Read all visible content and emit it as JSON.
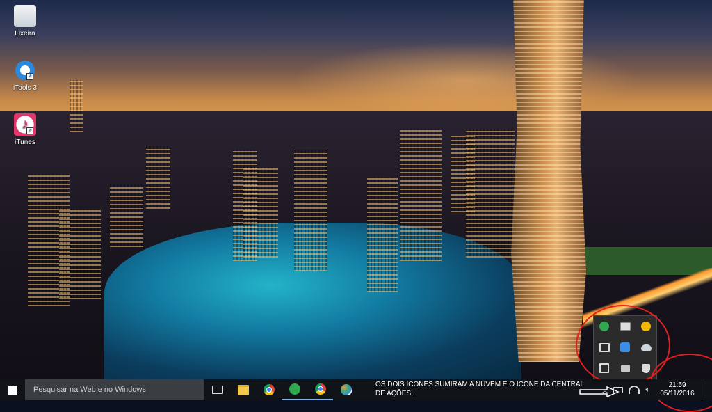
{
  "desktop": {
    "icons": [
      {
        "label": "Lixeira"
      },
      {
        "label": "iTools 3"
      },
      {
        "label": "iTunes"
      }
    ]
  },
  "taskbar": {
    "search_placeholder": "Pesquisar na Web e no Windows",
    "annotation_text": "OS DOIS ICONES SUMIRAM A NUVEM E O ICONE DA CENTRAL DE AÇÕES,",
    "clock": {
      "time": "21:59",
      "date": "05/11/2016"
    }
  },
  "tray_flyout": {
    "icons": [
      "green-circle-icon",
      "card-icon",
      "yellow-circle-icon",
      "window-icon",
      "blue-app-icon",
      "cloud-icon",
      "upload-icon",
      "chat-icon",
      "shield-icon"
    ]
  },
  "colors": {
    "annotation_red": "#e02020",
    "taskbar_bg": "#101418",
    "search_bg": "#3a3d42"
  }
}
